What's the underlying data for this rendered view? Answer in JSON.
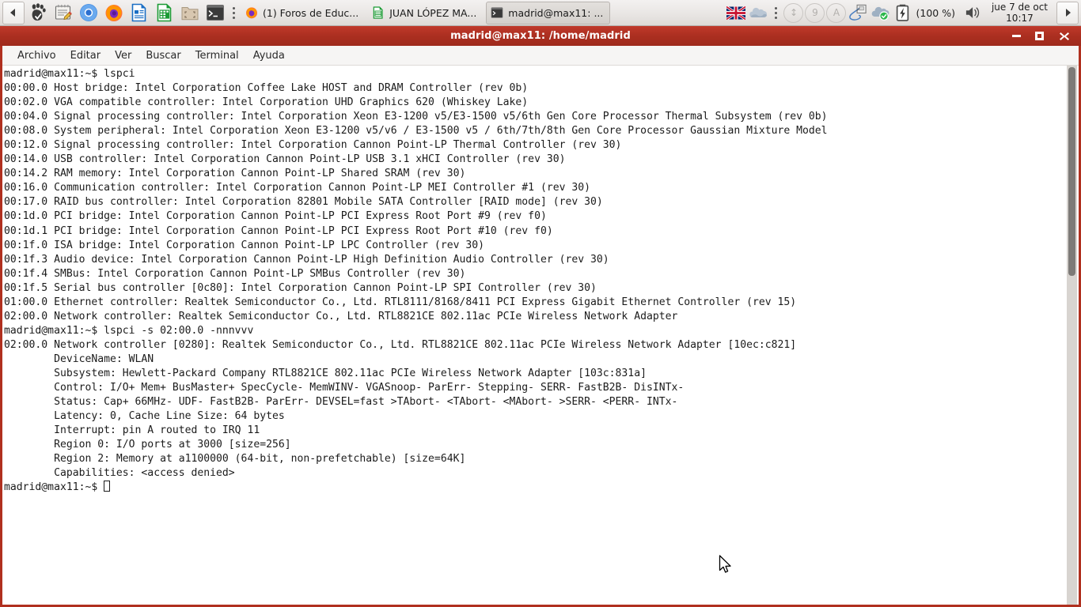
{
  "taskbar": {
    "show_desktop_label": "◀",
    "launchers": [
      {
        "name": "gnome-foot-icon",
        "label": "GNOME"
      },
      {
        "name": "text-editor-icon",
        "label": "Editor de textos"
      },
      {
        "name": "chromium-icon",
        "label": "Chromium"
      },
      {
        "name": "firefox-icon",
        "label": "Firefox"
      },
      {
        "name": "libreoffice-writer-icon",
        "label": "LibreOffice Writer"
      },
      {
        "name": "libreoffice-calc-icon",
        "label": "LibreOffice Calc"
      },
      {
        "name": "file-manager-icon",
        "label": "Archivos"
      },
      {
        "name": "terminal-icon",
        "label": "Terminal"
      }
    ],
    "windows": [
      {
        "name": "window-button-firefox",
        "label": "(1) Foros de Educ...",
        "icon": "firefox-icon",
        "active": false
      },
      {
        "name": "window-button-calc",
        "label": "JUAN LÓPEZ MA...",
        "icon": "libreoffice-calc-icon",
        "active": false
      },
      {
        "name": "window-button-terminal",
        "label": "madrid@max11: ...",
        "icon": "terminal-icon",
        "active": true
      }
    ],
    "tray": {
      "keyboard_layout": "flag-uk-icon",
      "cloud": "cloud-icon",
      "indicator_updown": "↕",
      "indicator_nine": "9",
      "indicator_a": "A",
      "pen": "pen-tablet-icon",
      "cloud_sync": "cloud-ok-icon",
      "battery_icon": "battery-charging-icon",
      "battery_percent": "(100 %)",
      "volume_icon": "volume-icon",
      "clock_date": "jue 7 de oct",
      "clock_time": "10:17",
      "expand_arrow": "▶"
    }
  },
  "terminal": {
    "title": "madrid@max11: /home/madrid",
    "menu": [
      "Archivo",
      "Editar",
      "Ver",
      "Buscar",
      "Terminal",
      "Ayuda"
    ],
    "window_buttons": {
      "minimize": "minimize-button",
      "maximize": "maximize-button",
      "close": "close-button"
    },
    "content": "madrid@max11:~$ lspci\n00:00.0 Host bridge: Intel Corporation Coffee Lake HOST and DRAM Controller (rev 0b)\n00:02.0 VGA compatible controller: Intel Corporation UHD Graphics 620 (Whiskey Lake)\n00:04.0 Signal processing controller: Intel Corporation Xeon E3-1200 v5/E3-1500 v5/6th Gen Core Processor Thermal Subsystem (rev 0b)\n00:08.0 System peripheral: Intel Corporation Xeon E3-1200 v5/v6 / E3-1500 v5 / 6th/7th/8th Gen Core Processor Gaussian Mixture Model\n00:12.0 Signal processing controller: Intel Corporation Cannon Point-LP Thermal Controller (rev 30)\n00:14.0 USB controller: Intel Corporation Cannon Point-LP USB 3.1 xHCI Controller (rev 30)\n00:14.2 RAM memory: Intel Corporation Cannon Point-LP Shared SRAM (rev 30)\n00:16.0 Communication controller: Intel Corporation Cannon Point-LP MEI Controller #1 (rev 30)\n00:17.0 RAID bus controller: Intel Corporation 82801 Mobile SATA Controller [RAID mode] (rev 30)\n00:1d.0 PCI bridge: Intel Corporation Cannon Point-LP PCI Express Root Port #9 (rev f0)\n00:1d.1 PCI bridge: Intel Corporation Cannon Point-LP PCI Express Root Port #10 (rev f0)\n00:1f.0 ISA bridge: Intel Corporation Cannon Point-LP LPC Controller (rev 30)\n00:1f.3 Audio device: Intel Corporation Cannon Point-LP High Definition Audio Controller (rev 30)\n00:1f.4 SMBus: Intel Corporation Cannon Point-LP SMBus Controller (rev 30)\n00:1f.5 Serial bus controller [0c80]: Intel Corporation Cannon Point-LP SPI Controller (rev 30)\n01:00.0 Ethernet controller: Realtek Semiconductor Co., Ltd. RTL8111/8168/8411 PCI Express Gigabit Ethernet Controller (rev 15)\n02:00.0 Network controller: Realtek Semiconductor Co., Ltd. RTL8821CE 802.11ac PCIe Wireless Network Adapter\nmadrid@max11:~$ lspci -s 02:00.0 -nnnvvv\n02:00.0 Network controller [0280]: Realtek Semiconductor Co., Ltd. RTL8821CE 802.11ac PCIe Wireless Network Adapter [10ec:c821]\n        DeviceName: WLAN\n        Subsystem: Hewlett-Packard Company RTL8821CE 802.11ac PCIe Wireless Network Adapter [103c:831a]\n        Control: I/O+ Mem+ BusMaster+ SpecCycle- MemWINV- VGASnoop- ParErr- Stepping- SERR- FastB2B- DisINTx-\n        Status: Cap+ 66MHz- UDF- FastB2B- ParErr- DEVSEL=fast >TAbort- <TAbort- <MAbort- >SERR- <PERR- INTx-\n        Latency: 0, Cache Line Size: 64 bytes\n        Interrupt: pin A routed to IRQ 11\n        Region 0: I/O ports at 3000 [size=256]\n        Region 2: Memory at a1100000 (64-bit, non-prefetchable) [size=64K]\n        Capabilities: <access denied>\n",
    "prompt": "madrid@max11:~$ "
  },
  "colors": {
    "window_frame": "#b0301f",
    "titlebar": "#ab2f20",
    "terminal_bg": "#ffffff",
    "terminal_fg": "#1b1b1b",
    "taskbar_bg": "#e9e6e4"
  }
}
